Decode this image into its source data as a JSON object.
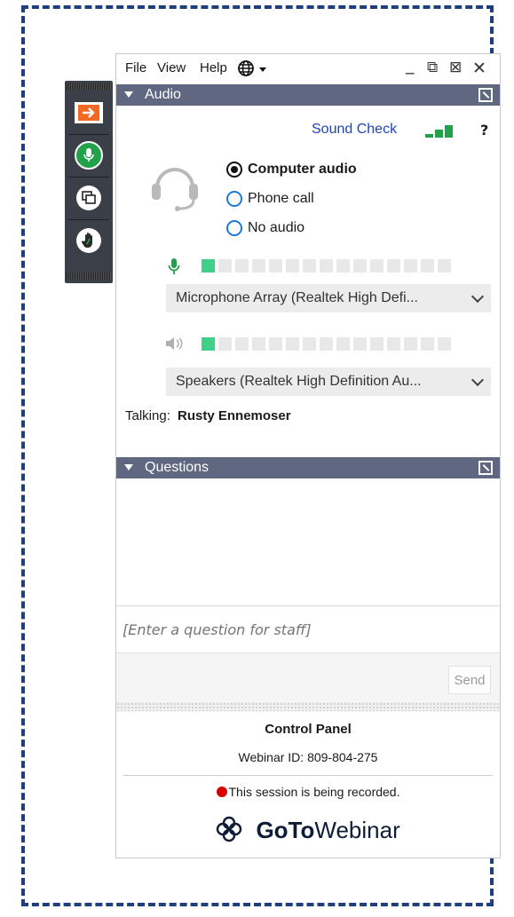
{
  "menu": {
    "file": "File",
    "view": "View",
    "help": "Help"
  },
  "window_controls": {
    "minimize": "_",
    "popout": "⧉",
    "expand": "⊠",
    "close": "✕"
  },
  "audio": {
    "header": "Audio",
    "sound_check": "Sound Check",
    "help_mark": "?",
    "options": [
      {
        "label": "Computer audio",
        "selected": true
      },
      {
        "label": "Phone call",
        "selected": false
      },
      {
        "label": "No audio",
        "selected": false
      }
    ],
    "microphone_device": "Microphone Array (Realtek High Defi...",
    "speaker_device": "Speakers (Realtek High Definition Au...",
    "mic_level_segments_on": 1,
    "speaker_level_segments_on": 1,
    "level_segments_total": 15,
    "talking_label": "Talking:",
    "talking_name": "Rusty Ennemoser"
  },
  "questions": {
    "header": "Questions",
    "input_placeholder": "[Enter a question for staff]",
    "send_label": "Send"
  },
  "footer": {
    "title": "Control Panel",
    "webinar_id": "Webinar ID: 809-804-275",
    "recording_notice": "This session is being recorded.",
    "brand_goto_bold": "GoTo",
    "brand_webinar": "Webinar"
  },
  "colors": {
    "header_bg": "#5f6880",
    "accent_blue": "#2242b8",
    "mic_green": "#22a04a",
    "level_on": "#3fd08a",
    "record_red": "#d60000",
    "toolbar_bg": "#3b3f47",
    "orange_arrow": "#f26a21",
    "frame_dash": "#1f3f7c"
  },
  "icons": [
    "arrow-right-icon",
    "microphone-icon",
    "screen-share-icon",
    "raise-hand-icon",
    "globe-icon",
    "headset-icon",
    "speaker-icon",
    "gotowebinar-logo-icon"
  ]
}
